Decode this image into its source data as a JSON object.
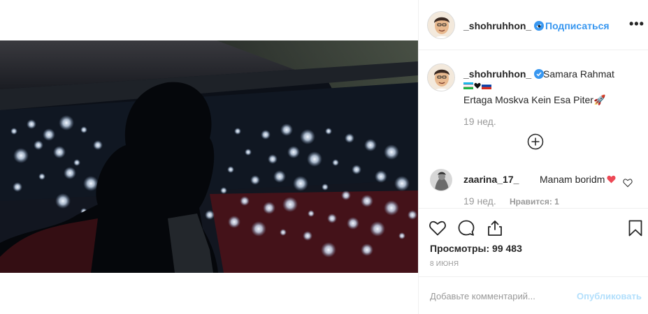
{
  "post": {
    "author": "_shohruhhon_",
    "follow_label": "Подписаться",
    "dot": "•",
    "more_label": "•••"
  },
  "caption": {
    "username": "_shohruhhon_",
    "text_line1": "Samara Rahmat",
    "text_line2": "Ertaga Moskva Kein Esa Piter🚀",
    "time": "19 нед."
  },
  "comment": {
    "username": "zaarina_17_",
    "text": "Manam boridm",
    "time": "19 нед.",
    "likes": "Нравится: 1"
  },
  "stats": {
    "views": "Просмотры: 99 483",
    "date": "8 ИЮНЯ"
  },
  "add_comment": {
    "placeholder": "Добавьте комментарий...",
    "post_label": "Опубликовать"
  },
  "colors": {
    "accent": "#3897f0",
    "post_disabled": "#b2dffc",
    "muted": "#999999",
    "heart_red": "#ed4956",
    "border": "#efefef"
  },
  "icons": {
    "verified": "verified-badge-icon",
    "more": "more-options-icon",
    "add": "plus-circle-icon",
    "like": "heart-icon",
    "comment": "comment-bubble-icon",
    "share": "share-icon",
    "save": "bookmark-icon"
  }
}
